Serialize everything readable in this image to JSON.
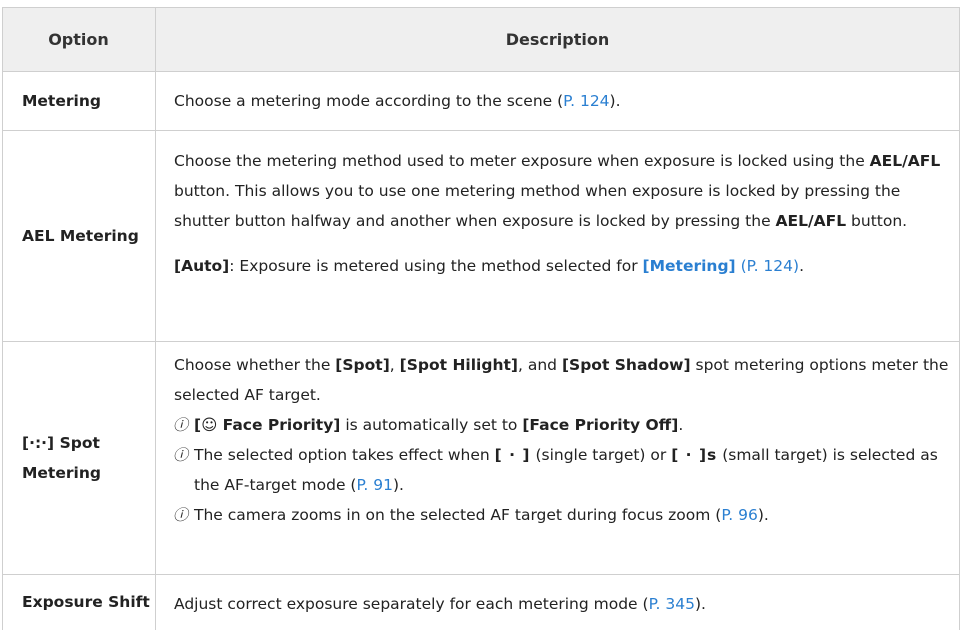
{
  "header": {
    "option": "Option",
    "description": "Description"
  },
  "rows": [
    {
      "option": "Metering",
      "desc": {
        "text": "Choose a metering mode according to the scene (",
        "link": "P. 124",
        "end": ")."
      }
    },
    {
      "option": "AEL Metering",
      "desc": {
        "t1": "Choose the metering method used to meter exposure when exposure is locked using the ",
        "b1": "AEL/AFL",
        "t2": " button. This allows you to use one metering method when exposure is locked by pressing the shutter button halfway and another when exposure is locked by pressing the ",
        "b2": "AEL/AFL",
        "t3": " button.",
        "auto_label": "[Auto]",
        "auto_text": ": Exposure is metered using the method selected for ",
        "auto_ref": "[Metering]",
        "auto_link": "(P. 124)",
        "auto_end": "."
      }
    },
    {
      "option_icon": "[∙:∙]",
      "option": "Spot Metering",
      "desc": {
        "t1": "Choose whether the ",
        "b1": "[Spot]",
        "t2": ", ",
        "b2": "[Spot Hilight]",
        "t3": ", and ",
        "b3": "[Spot Shadow]",
        "t4": " spot metering options meter the selected AF target.",
        "note_mark": "ⓘ",
        "note1_b1": "[☺ Face Priority]",
        "note1_t": " is automatically set to ",
        "note1_b2": "[Face Priority Off]",
        "note1_end": ".",
        "note2_t1": "The selected option takes effect when ",
        "note2_i1": "[ · ]",
        "note2_t2": " (single target) or ",
        "note2_i2": "[ · ]s",
        "note2_t3": " (small target) is selected as the AF-target mode (",
        "note2_link": "P. 91",
        "note2_end": ").",
        "note3_t": "The camera zooms in on the selected AF target during focus zoom (",
        "note3_link": "P. 96",
        "note3_end": ")."
      }
    },
    {
      "option": "Exposure Shift",
      "desc": {
        "text": "Adjust correct exposure separately for each metering mode (",
        "link": "P. 345",
        "end": ")."
      }
    }
  ],
  "colors": {
    "link": "#2a7fd1",
    "header_bg": "#efefef",
    "border": "#cfcfcf"
  }
}
